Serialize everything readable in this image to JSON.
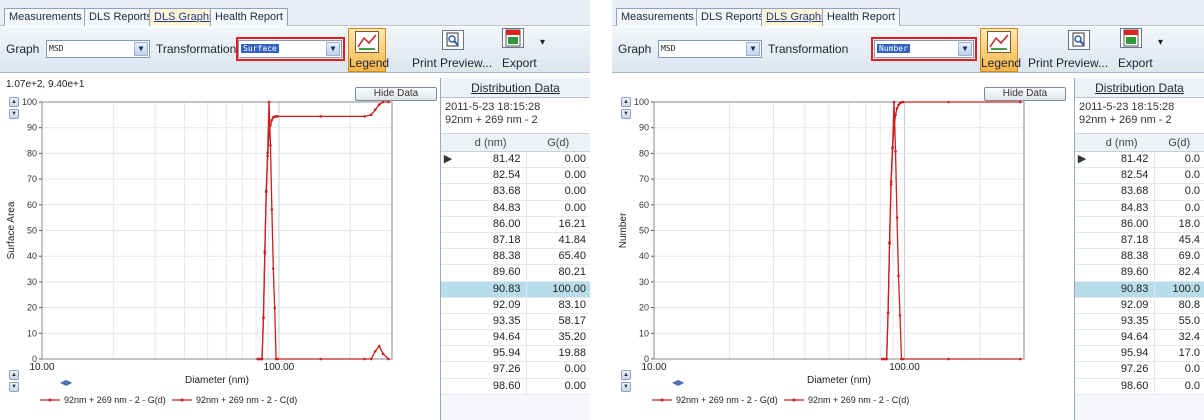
{
  "colors": {
    "curve": "#cc1f1f",
    "highlight_box": "#e01c1c",
    "selected_row": "#b7dcea",
    "tab_active_bg": "#fff4d6"
  },
  "tabs": [
    "Measurements",
    "DLS Reports",
    "DLS Graphs",
    "Health Report"
  ],
  "toolbar": {
    "graph_label": "Graph",
    "graph_value": "MSD",
    "transformation_label": "Transformation",
    "legend_label": "Legend",
    "print_preview_label": "Print Preview...",
    "export_label": "Export",
    "dropdown_caret": "▾",
    "combo_arrow": "▼",
    "icons": [
      "chevron-down-icon",
      "legend-chart-icon",
      "print-preview-icon",
      "export-pdf-icon"
    ]
  },
  "left": {
    "transformation_value": "Surface",
    "coords_readout": "1.07e+2, 9.40e+1",
    "hide_data_label": "Hide Data",
    "ylabel": "Surface Area",
    "xlabel": "Diameter (nm)",
    "legend_gd": "92nm + 269 nm - 2 - G(d)",
    "legend_cd": "92nm + 269 nm - 2 - C(d)"
  },
  "right": {
    "transformation_value": "Number",
    "hide_data_label": "Hide Data",
    "ylabel": "Number",
    "xlabel": "Diameter (nm)",
    "legend_gd": "92nm + 269 nm - 2 - G(d)",
    "legend_cd": "92nm + 269 nm - 2 - C(d)"
  },
  "distribution": {
    "title": "Distribution Data",
    "sample_datetime": "2011-5-23 18:15:28",
    "sample_name": "92nm + 269 nm - 2",
    "col_d": "d (nm)",
    "col_g": "G(d)",
    "row_indicator": "▶",
    "selected_index": 8,
    "d_values": [
      "81.42",
      "82.54",
      "83.68",
      "84.83",
      "86.00",
      "87.18",
      "88.38",
      "89.60",
      "90.83",
      "92.09",
      "93.35",
      "94.64",
      "95.94",
      "97.26",
      "98.60"
    ],
    "g_left": [
      "0.00",
      "0.00",
      "0.00",
      "0.00",
      "16.21",
      "41.84",
      "65.40",
      "80.21",
      "100.00",
      "83.10",
      "58.17",
      "35.20",
      "19.88",
      "0.00",
      "0.00"
    ],
    "g_right": [
      "0.0",
      "0.0",
      "0.0",
      "0.0",
      "18.0",
      "45.4",
      "69.0",
      "82.4",
      "100.0",
      "80.8",
      "55.0",
      "32.4",
      "17.0",
      "0.0",
      "0.0"
    ]
  },
  "chart_data": [
    {
      "type": "line",
      "transformation": "Surface",
      "xscale": "log",
      "xlim": [
        10,
        300
      ],
      "ylim": [
        0,
        100
      ],
      "xticks": [
        "10.00",
        "100.00"
      ],
      "yticks": [
        "0",
        "10",
        "20",
        "30",
        "40",
        "50",
        "60",
        "70",
        "80",
        "90",
        "100"
      ],
      "xlabel": "Diameter (nm)",
      "ylabel": "Surface Area",
      "grid": true,
      "legend": "bottom",
      "series": [
        {
          "name": "92nm + 269 nm - 2 - G(d)",
          "x": [
            81.42,
            82.54,
            83.68,
            84.83,
            86.0,
            87.18,
            88.38,
            89.6,
            90.83,
            92.09,
            93.35,
            94.64,
            95.94,
            97.26,
            98.6,
            150,
            230,
            245,
            255,
            265,
            275,
            290
          ],
          "y": [
            0,
            0,
            0,
            0,
            16.21,
            41.84,
            65.4,
            80.21,
            100.0,
            83.1,
            58.17,
            35.2,
            19.88,
            0,
            0,
            0,
            0,
            0,
            3,
            5,
            2,
            0
          ]
        },
        {
          "name": "92nm + 269 nm - 2 - C(d)",
          "x": [
            81.42,
            84.83,
            86.0,
            87.18,
            88.38,
            89.6,
            90.83,
            92.09,
            93.35,
            94.64,
            95.94,
            97.26,
            98.6,
            150,
            230,
            245,
            255,
            265,
            275,
            290
          ],
          "y": [
            0,
            0,
            16,
            41,
            65,
            79,
            88,
            91,
            93,
            94,
            94.3,
            94.4,
            94.4,
            94.4,
            94.4,
            95,
            97,
            99,
            100,
            100
          ]
        }
      ]
    },
    {
      "type": "line",
      "transformation": "Number",
      "xscale": "log",
      "xlim": [
        10,
        300
      ],
      "ylim": [
        0,
        100
      ],
      "xticks": [
        "10.00",
        "100.00"
      ],
      "yticks": [
        "0",
        "10",
        "20",
        "30",
        "40",
        "50",
        "60",
        "70",
        "80",
        "90",
        "100"
      ],
      "xlabel": "Diameter (nm)",
      "ylabel": "Number",
      "grid": true,
      "legend": "bottom",
      "series": [
        {
          "name": "92nm + 269 nm - 2 - G(d)",
          "x": [
            81.42,
            82.54,
            83.68,
            84.83,
            86.0,
            87.18,
            88.38,
            89.6,
            90.83,
            92.09,
            93.35,
            94.64,
            95.94,
            97.26,
            98.6,
            150,
            290
          ],
          "y": [
            0,
            0,
            0,
            0,
            18.0,
            45.4,
            69.0,
            82.4,
            100.0,
            80.8,
            55.0,
            32.4,
            17.0,
            0,
            0,
            0,
            0
          ]
        },
        {
          "name": "92nm + 269 nm - 2 - C(d)",
          "x": [
            81.42,
            84.83,
            86.0,
            87.18,
            88.38,
            89.6,
            90.83,
            92.09,
            93.35,
            94.64,
            95.94,
            97.26,
            98.6,
            150,
            290
          ],
          "y": [
            0,
            0,
            18,
            45,
            68,
            82,
            90,
            95,
            97.5,
            98.8,
            99.5,
            99.9,
            100,
            100,
            100
          ]
        }
      ]
    }
  ]
}
